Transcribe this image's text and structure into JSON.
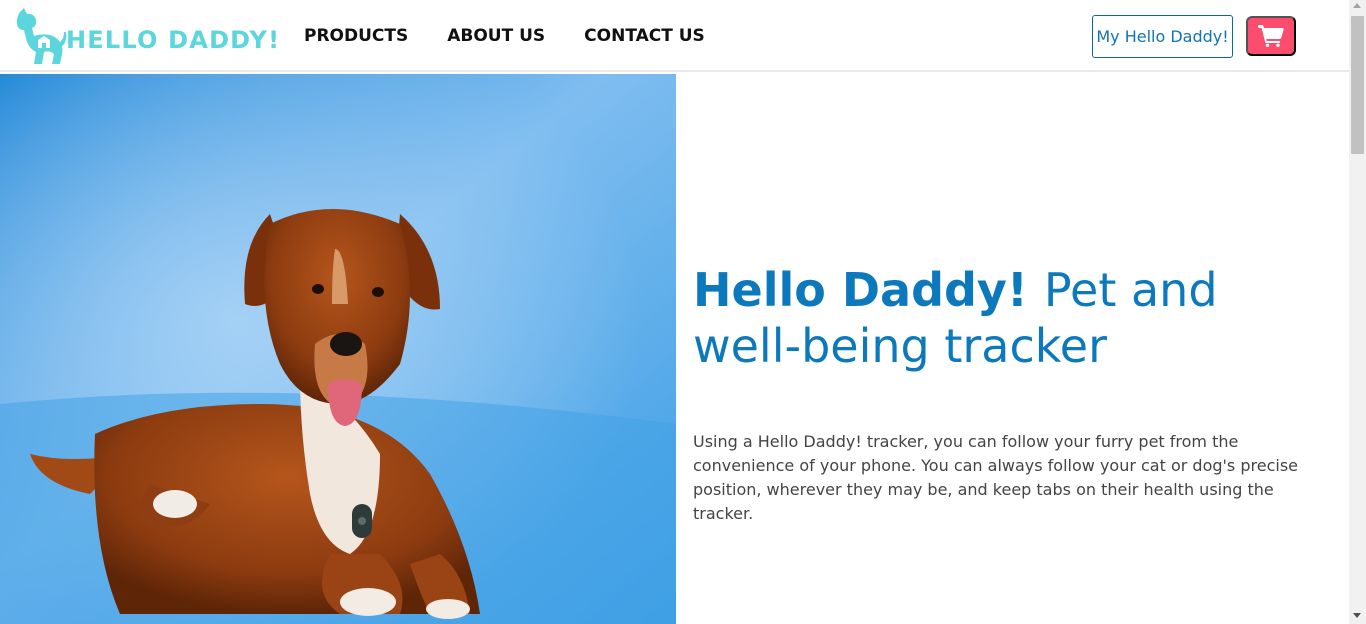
{
  "header": {
    "logo_text": "HELLO DADDY!",
    "logo_icon": "dog-silhouette-icon",
    "nav": [
      {
        "label": "PRODUCTS"
      },
      {
        "label": "ABOUT US"
      },
      {
        "label": "CONTACT US"
      }
    ],
    "account_button_label": "My Hello Daddy!",
    "cart_icon": "shopping-cart-icon"
  },
  "hero": {
    "title_strong": "Hello Daddy!",
    "title_rest": "Pet and well-being tracker",
    "description": "Using a Hello Daddy! tracker, you can follow your furry pet from the convenience of your phone. You can always follow your cat or dog's precise position, wherever they may be, and keep tabs on their health using the tracker."
  },
  "colors": {
    "brand_teal": "#5ad6dc",
    "brand_blue": "#0d79bd",
    "cart_pink": "#fd4d6e",
    "hero_bg_blue": "#3e9fe0"
  }
}
